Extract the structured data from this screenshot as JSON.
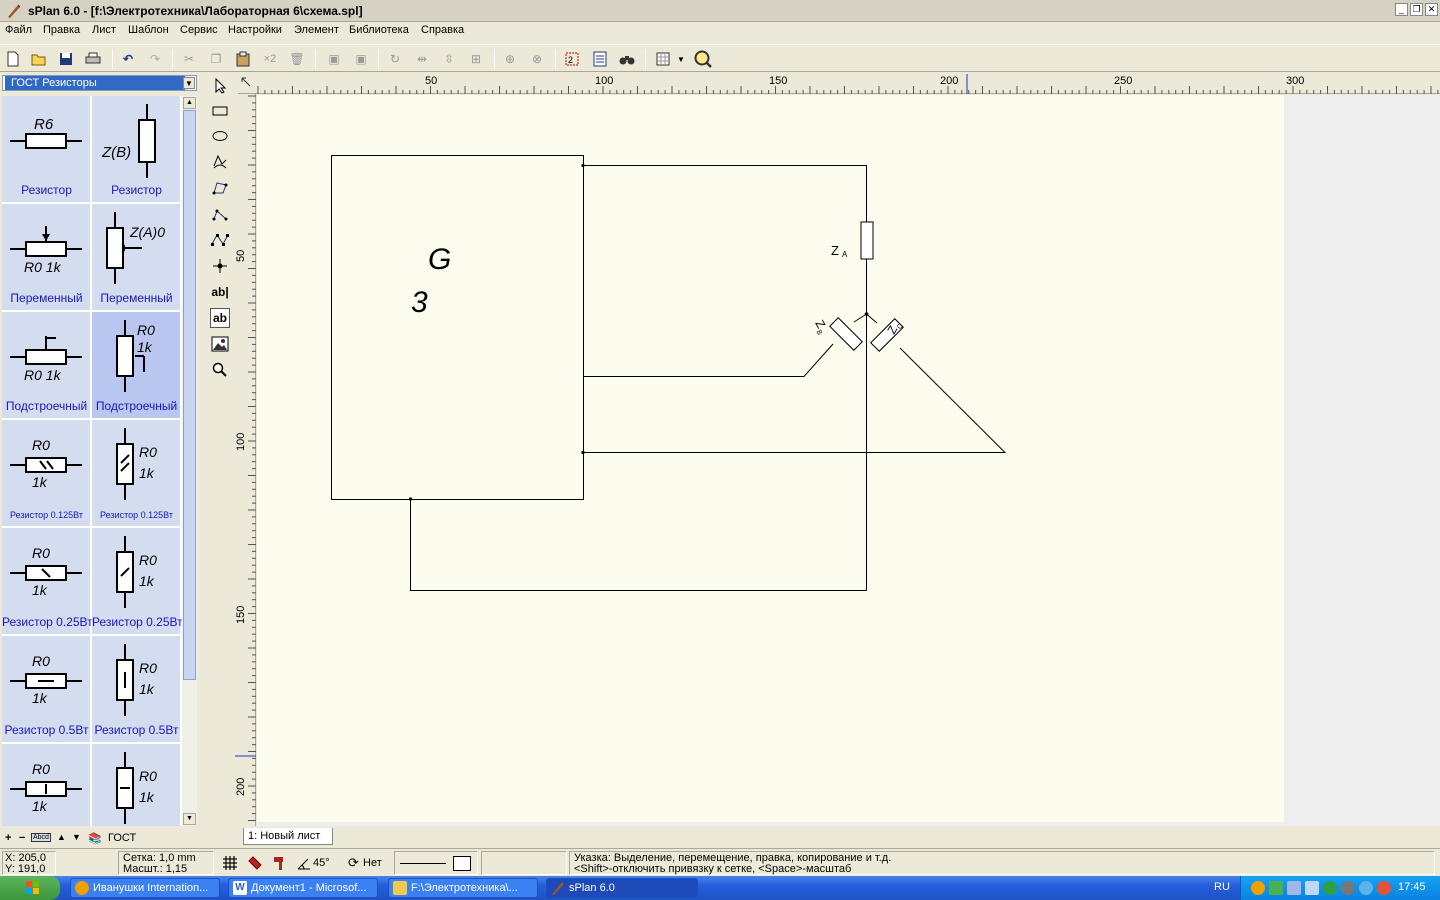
{
  "window": {
    "title": "sPlan 6.0 - [f:\\Электротехника\\Лабораторная 6\\схема.spl]",
    "controls": [
      "minimize",
      "restore",
      "close"
    ]
  },
  "menu": [
    "Файл",
    "Правка",
    "Лист",
    "Шаблон",
    "Сервис",
    "Настройки",
    "Элемент",
    "Библиотека",
    "Справка"
  ],
  "toolbar": {
    "icons": [
      "new-icon",
      "open-icon",
      "save-icon",
      "print-icon",
      "undo-icon",
      "redo-icon",
      "cut-icon",
      "copy-icon",
      "paste-icon",
      "duplicate-icon",
      "delete-icon",
      "to-front-icon",
      "to-back-icon",
      "rotate-icon",
      "mirror-h-icon",
      "mirror-v-icon",
      "group-icon",
      "lock-icon",
      "unlock-icon",
      "numbering-icon",
      "partlist-icon",
      "search-icon",
      "grid-options-icon",
      "zoom-icon"
    ],
    "duplicate_label": "×2"
  },
  "library": {
    "selected": "ГОСТ Резисторы",
    "cells": [
      {
        "label": "Резистор",
        "t1": "R6",
        "t2": ""
      },
      {
        "label": "Резистор",
        "t1": "Z(B)",
        "t2": ""
      },
      {
        "label": "Переменный",
        "t1": "R0 1k",
        "t2": ""
      },
      {
        "label": "Переменный",
        "t1": "Z(A)0",
        "t2": ""
      },
      {
        "label": "Подстроечный",
        "t1": "R0  1k",
        "t2": ""
      },
      {
        "label": "Подстроечный",
        "t1": "R0",
        "t2": "1k"
      },
      {
        "label": "Резистор 0.125Вт",
        "t1": "R0",
        "t2": "1k"
      },
      {
        "label": "Резистор 0.125Вт",
        "t1": "R0",
        "t2": "1k"
      },
      {
        "label": "Резистор 0.25Вт",
        "t1": "R0",
        "t2": "1k"
      },
      {
        "label": "Резистор 0.25Вт",
        "t1": "R0",
        "t2": "1k"
      },
      {
        "label": "Резистор 0.5Вт",
        "t1": "R0",
        "t2": "1k"
      },
      {
        "label": "Резистор 0.5Вт",
        "t1": "R0",
        "t2": "1k"
      },
      {
        "label": "",
        "t1": "R0",
        "t2": "1k"
      },
      {
        "label": "",
        "t1": "R0",
        "t2": "1k"
      }
    ],
    "footer": {
      "plus": "+",
      "minus": "−",
      "abcd": "Abcd",
      "up": "▲",
      "down": "▼",
      "group": "ГОСТ"
    }
  },
  "rulers": {
    "h_ticks": [
      "50",
      "100",
      "150",
      "200",
      "250",
      "300"
    ],
    "v_ticks": [
      "50",
      "100",
      "150",
      "200"
    ]
  },
  "schematic": {
    "generator_label": "G",
    "generator_number": "3",
    "za": "Z",
    "za_sub": "A",
    "zb": "Z",
    "zb_sub": "B",
    "zc": "Z",
    "zc_sub": "C"
  },
  "tabs": [
    {
      "label": "1: Новый лист"
    }
  ],
  "status": {
    "x": "X: 205,0",
    "y": "Y: 191,0",
    "grid": "Сетка:  1,0 mm",
    "scale": "Масшт.:  1,15",
    "angle": "45°",
    "rotation": "Нет",
    "hint1": "Указка: Выделение, перемещение, правка, копирование и т.д.",
    "hint2": "<Shift>-отключить привязку к сетке, <Space>-масштаб"
  },
  "taskbar": {
    "tasks": [
      {
        "label": "Иванушки Internation...",
        "color": "#f0a000"
      },
      {
        "label": "Документ1 - Microsof...",
        "color": "#2a5bd7"
      },
      {
        "label": "F:\\Электротехника\\...",
        "color": "#f2c94c"
      },
      {
        "label": "sPlan 6.0",
        "color": "#a0522d"
      }
    ],
    "lang": "RU",
    "clock": "17:45"
  }
}
